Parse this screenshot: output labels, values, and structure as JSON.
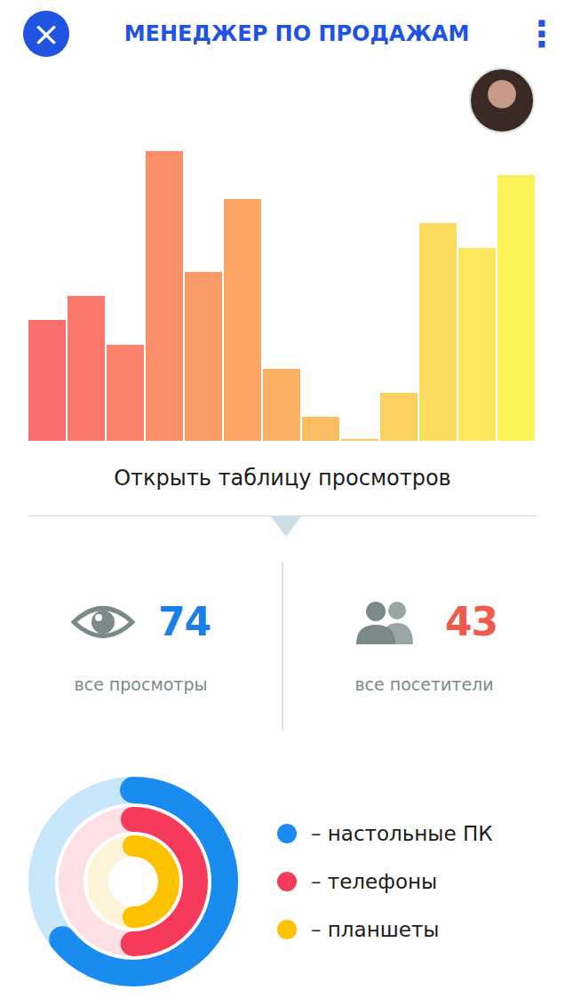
{
  "header": {
    "close_icon": "×",
    "title": "МЕНЕДЖЕР ПО ПРОДАЖАМ",
    "menu_icon": "⋮"
  },
  "chart": {
    "values": [
      136,
      163,
      108,
      326,
      190,
      272,
      81,
      27,
      2,
      54,
      245,
      217,
      299
    ]
  },
  "table_link": {
    "label": "Открыть таблицу просмотров"
  },
  "stats": [
    {
      "value": "74",
      "label": "все просмотры",
      "kind": "views",
      "color": "#1a7fe6"
    },
    {
      "value": "43",
      "label": "все посетители",
      "kind": "visitors",
      "color": "#ef5a4a"
    }
  ],
  "devices": [
    {
      "label": "– настольные ПК",
      "level": 0.64,
      "color": "#1a8cf0",
      "track": "#c9e7fb"
    },
    {
      "label": "– телефоны",
      "level": 0.5,
      "color": "#f53a5c",
      "track": "#fde0e6"
    },
    {
      "label": "– планшеты",
      "level": 0.5,
      "color": "#fcc200",
      "track": "#fdf4da"
    }
  ]
}
